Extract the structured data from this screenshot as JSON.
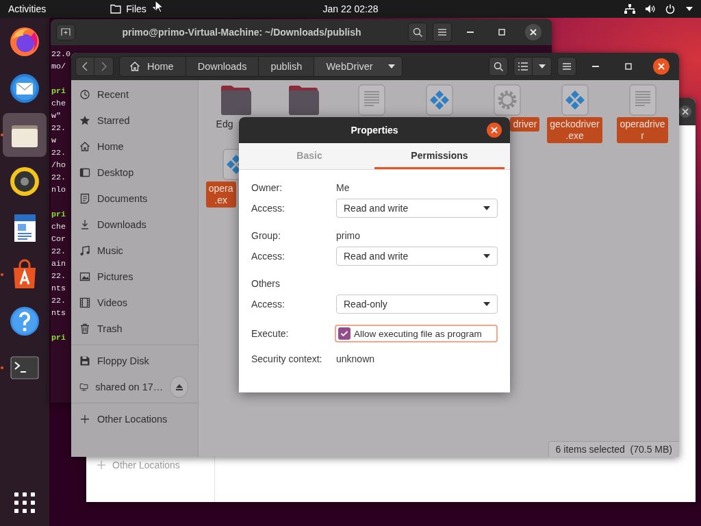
{
  "top_bar": {
    "activities": "Activities",
    "app_menu": "Files",
    "clock": "Jan 22  02:28"
  },
  "dock": {
    "items": [
      {
        "kind": "firefox",
        "running": false,
        "selected": false
      },
      {
        "kind": "mail",
        "running": false,
        "selected": false
      },
      {
        "kind": "files",
        "running": true,
        "selected": true
      },
      {
        "kind": "music",
        "running": false,
        "selected": false
      },
      {
        "kind": "writer",
        "running": false,
        "selected": false
      },
      {
        "kind": "store",
        "running": true,
        "selected": false
      },
      {
        "kind": "help",
        "running": false,
        "selected": false
      },
      {
        "kind": "terminal",
        "running": true,
        "selected": false
      }
    ]
  },
  "terminal": {
    "title": "primo@primo-Virtual-Machine: ~/Downloads/publish",
    "lines": [
      {
        "kind": "output",
        "text": "22.0"
      },
      {
        "kind": "output",
        "text": "mo/"
      },
      {
        "kind": "blank"
      },
      {
        "kind": "prompt",
        "text": "pri"
      },
      {
        "kind": "output",
        "text": "che"
      },
      {
        "kind": "output",
        "text": "w\""
      },
      {
        "kind": "output",
        "text": "22."
      },
      {
        "kind": "output",
        "text": "w"
      },
      {
        "kind": "output",
        "text": "22."
      },
      {
        "kind": "output",
        "text": "/ho"
      },
      {
        "kind": "output",
        "text": "22."
      },
      {
        "kind": "output",
        "text": "nlo"
      },
      {
        "kind": "blank"
      },
      {
        "kind": "prompt",
        "text": "pri"
      },
      {
        "kind": "output",
        "text": "che"
      },
      {
        "kind": "output",
        "text": "Cor"
      },
      {
        "kind": "output",
        "text": "22."
      },
      {
        "kind": "output",
        "text": "ain"
      },
      {
        "kind": "output",
        "text": "22."
      },
      {
        "kind": "output",
        "text": "nts"
      },
      {
        "kind": "output",
        "text": "22."
      },
      {
        "kind": "output",
        "text": "nts"
      },
      {
        "kind": "blank"
      },
      {
        "kind": "prompt",
        "text": "pri"
      }
    ]
  },
  "back_window": {
    "sidebar_items": [
      {
        "label": "Other Locations"
      }
    ]
  },
  "files_window": {
    "path": [
      {
        "label": "Home",
        "kind": "home",
        "selected": false
      },
      {
        "label": "Downloads",
        "selected": false
      },
      {
        "label": "publish",
        "selected": false
      },
      {
        "label": "WebDriver",
        "selected": true
      }
    ],
    "places": [
      {
        "label": "Recent",
        "kind": "recent",
        "selected": false
      },
      {
        "label": "Starred",
        "kind": "starred",
        "selected": false
      },
      {
        "label": "Home",
        "kind": "home",
        "selected": false
      },
      {
        "label": "Desktop",
        "kind": "desktop",
        "selected": false
      },
      {
        "label": "Documents",
        "kind": "documents",
        "selected": false
      },
      {
        "label": "Downloads",
        "kind": "downloads",
        "selected": false
      },
      {
        "label": "Music",
        "kind": "music",
        "selected": false
      },
      {
        "label": "Pictures",
        "kind": "pictures",
        "selected": false
      },
      {
        "label": "Videos",
        "kind": "videos",
        "selected": false
      },
      {
        "label": "Trash",
        "kind": "trash",
        "selected": false
      }
    ],
    "devices": [
      {
        "label": "Floppy Disk",
        "kind": "floppy",
        "selected": false,
        "eject": false
      },
      {
        "label": "shared on 17…",
        "kind": "share",
        "selected": false,
        "eject": true
      }
    ],
    "other": {
      "label": "Other Locations",
      "kind": "plus",
      "selected": false
    },
    "files": [
      {
        "kind": "folder",
        "label": [
          "Edg"
        ],
        "selected": false,
        "cut_right": true
      },
      {
        "kind": "folder"
      },
      {
        "kind": "text"
      },
      {
        "kind": "exe"
      },
      {
        "kind": "gear",
        "label": [
          "driver"
        ],
        "selected": true,
        "cut_left": true
      },
      {
        "kind": "exe",
        "label": [
          "geckodriver",
          ".exe"
        ],
        "selected": true
      },
      {
        "kind": "text",
        "label": [
          "operadrive",
          "r"
        ],
        "selected": true
      },
      {
        "kind": "exe",
        "label": [
          "opera",
          ".ex"
        ],
        "selected": true,
        "cut_right": true
      }
    ],
    "status": "6 items selected  (70.5 MB)"
  },
  "properties_dialog": {
    "title": "Properties",
    "tabs": [
      {
        "label": "Basic",
        "selected": false
      },
      {
        "label": "Permissions",
        "selected": true
      }
    ],
    "rows": [
      {
        "kind": "text",
        "label": "Owner:",
        "value": "Me"
      },
      {
        "kind": "dropdown",
        "label": "Access:",
        "value": "Read and write"
      },
      {
        "kind": "text",
        "label": "Group:",
        "value": "primo"
      },
      {
        "kind": "dropdown",
        "label": "Access:",
        "value": "Read and write"
      },
      {
        "kind": "heading",
        "label": "Others"
      },
      {
        "kind": "dropdown",
        "label": "Access:",
        "value": "Read-only"
      },
      {
        "kind": "checkbox",
        "label": "Execute:",
        "value": "Allow executing file as program",
        "checked": true,
        "focused": true
      },
      {
        "kind": "text",
        "label": "Security context:",
        "value": "unknown"
      }
    ]
  }
}
